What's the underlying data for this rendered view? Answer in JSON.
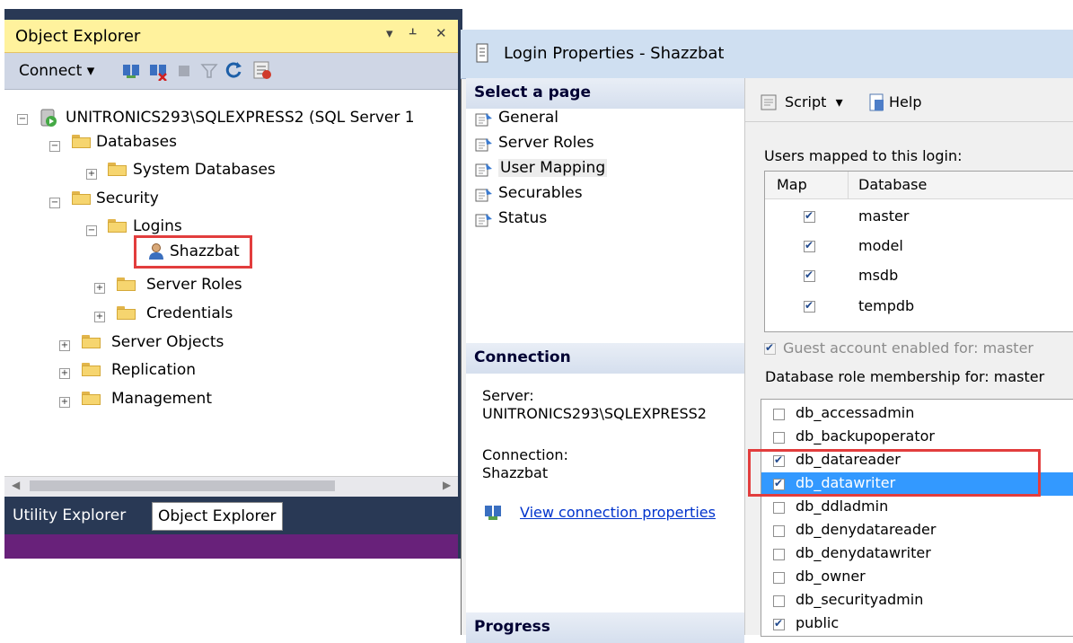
{
  "object_explorer": {
    "title": "Object Explorer",
    "pin_glyph": "▾ ⊥",
    "close_glyph": "✕",
    "connect_label": "Connect",
    "tree": {
      "server": "UNITRONICS293\\SQLEXPRESS2 (SQL Server 1",
      "databases": "Databases",
      "system_databases": "System Databases",
      "security": "Security",
      "logins": "Logins",
      "login_user": "Shazzbat",
      "server_roles": "Server Roles",
      "credentials": "Credentials",
      "server_objects": "Server Objects",
      "replication": "Replication",
      "management": "Management"
    },
    "tabs": [
      "Utility Explorer",
      "Object Explorer"
    ]
  },
  "dialog": {
    "title": "Login Properties - Shazzbat",
    "select_page_header": "Select a page",
    "pages": [
      "General",
      "Server Roles",
      "User Mapping",
      "Securables",
      "Status"
    ],
    "selected_page": "User Mapping",
    "connection_header": "Connection",
    "server_label": "Server:",
    "server_value": "UNITRONICS293\\SQLEXPRESS2",
    "connection_label": "Connection:",
    "connection_value": "Shazzbat",
    "view_connection_properties": "View connection properties",
    "progress_header": "Progress",
    "toolbar": {
      "script_label": "Script",
      "help_label": "Help"
    },
    "users_mapped_label": "Users mapped to this login:",
    "mapping_columns": [
      "Map",
      "Database"
    ],
    "mapping_rows": [
      {
        "database": "master",
        "mapped": true
      },
      {
        "database": "model",
        "mapped": true
      },
      {
        "database": "msdb",
        "mapped": true
      },
      {
        "database": "tempdb",
        "mapped": true
      }
    ],
    "guest_label": "Guest account enabled for: master",
    "role_membership_label": "Database role membership for: master",
    "roles": [
      {
        "name": "db_accessadmin",
        "checked": false
      },
      {
        "name": "db_backupoperator",
        "checked": false
      },
      {
        "name": "db_datareader",
        "checked": true
      },
      {
        "name": "db_datawriter",
        "checked": true
      },
      {
        "name": "db_ddladmin",
        "checked": false
      },
      {
        "name": "db_denydatareader",
        "checked": false
      },
      {
        "name": "db_denydatawriter",
        "checked": false
      },
      {
        "name": "db_owner",
        "checked": false
      },
      {
        "name": "db_securityadmin",
        "checked": false
      },
      {
        "name": "public",
        "checked": true
      }
    ],
    "selected_role": "db_datawriter"
  },
  "colors": {
    "selection_blue": "#3399ff",
    "highlight_red": "#e23d3d",
    "link_blue": "#0033cc"
  }
}
